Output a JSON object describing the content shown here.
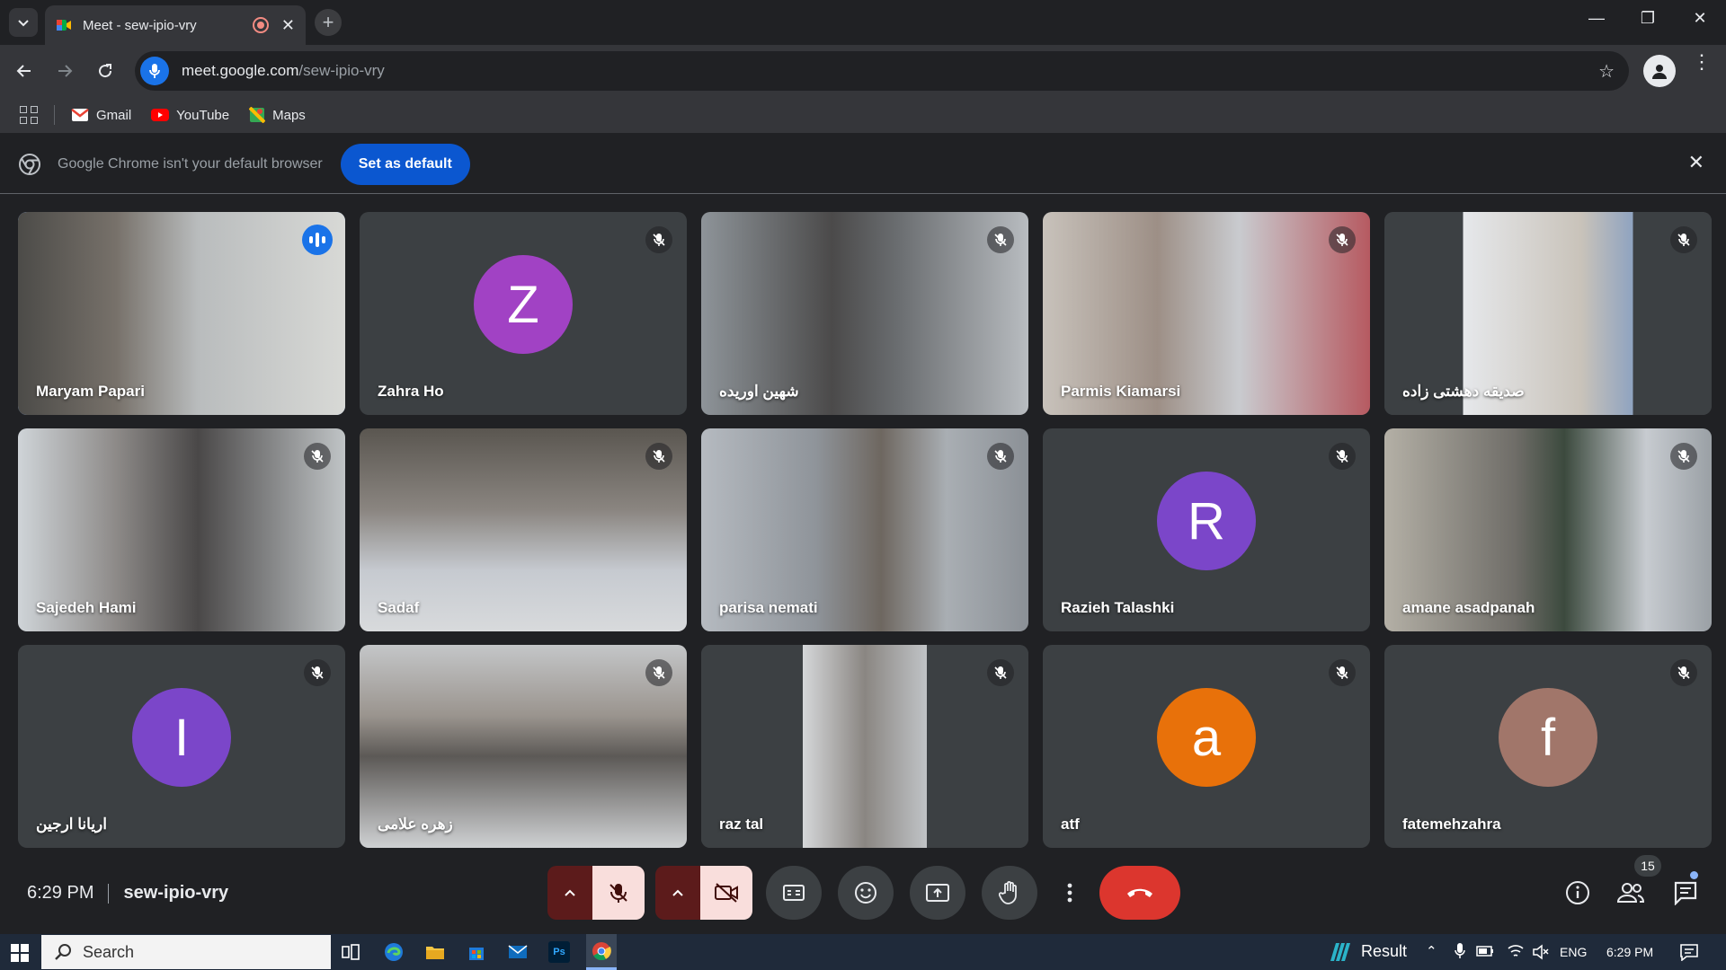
{
  "browser": {
    "tab_title": "Meet - sew-ipio-vry",
    "tab_close": "✕",
    "new_tab": "+",
    "url_domain": "meet.google.com",
    "url_path": "/sew-ipio-vry",
    "minimize": "—",
    "restore": "❐",
    "close": "✕",
    "bookmarks": [
      {
        "label": "Gmail"
      },
      {
        "label": "YouTube"
      },
      {
        "label": "Maps"
      }
    ],
    "infobar_message": "Google Chrome isn't your default browser",
    "infobar_button": "Set as default",
    "infobar_close": "✕"
  },
  "meet": {
    "tiles": [
      {
        "name": "Maryam Papari",
        "type": "video",
        "speaking": true
      },
      {
        "name": "Zahra Ho",
        "type": "avatar",
        "initial": "Z",
        "color": "#a142c4"
      },
      {
        "name": "شهین اوریده",
        "type": "video"
      },
      {
        "name": "Parmis Kiamarsi",
        "type": "video"
      },
      {
        "name": "صدیقه دهشتی زاده",
        "type": "video"
      },
      {
        "name": "Sajedeh Hami",
        "type": "video"
      },
      {
        "name": "Sadaf",
        "type": "video"
      },
      {
        "name": "parisa nemati",
        "type": "video"
      },
      {
        "name": "Razieh Talashki",
        "type": "avatar",
        "initial": "R",
        "color": "#7b46c9"
      },
      {
        "name": "amane asadpanah",
        "type": "video"
      },
      {
        "name": "اریانا ارجین",
        "type": "avatar",
        "initial": "I",
        "color": "#7b46c9"
      },
      {
        "name": "زهره علامی",
        "type": "video"
      },
      {
        "name": "raz tal",
        "type": "video"
      },
      {
        "name": "atf",
        "type": "avatar",
        "initial": "a",
        "color": "#e8710a"
      },
      {
        "name": "fatemehzahra",
        "type": "avatar",
        "initial": "f",
        "color": "#a1766a"
      }
    ],
    "time": "6:29 PM",
    "meeting_code": "sew-ipio-vry",
    "participant_count": "15"
  },
  "taskbar": {
    "search_label": "Search",
    "ps_label": "Ps",
    "weather": "Result",
    "lang": "ENG",
    "time": "6:29 PM"
  },
  "colors": {
    "accent": "#8ab4f8",
    "hangup": "#dc362e",
    "mic_off_bg": "#f9dedc"
  }
}
